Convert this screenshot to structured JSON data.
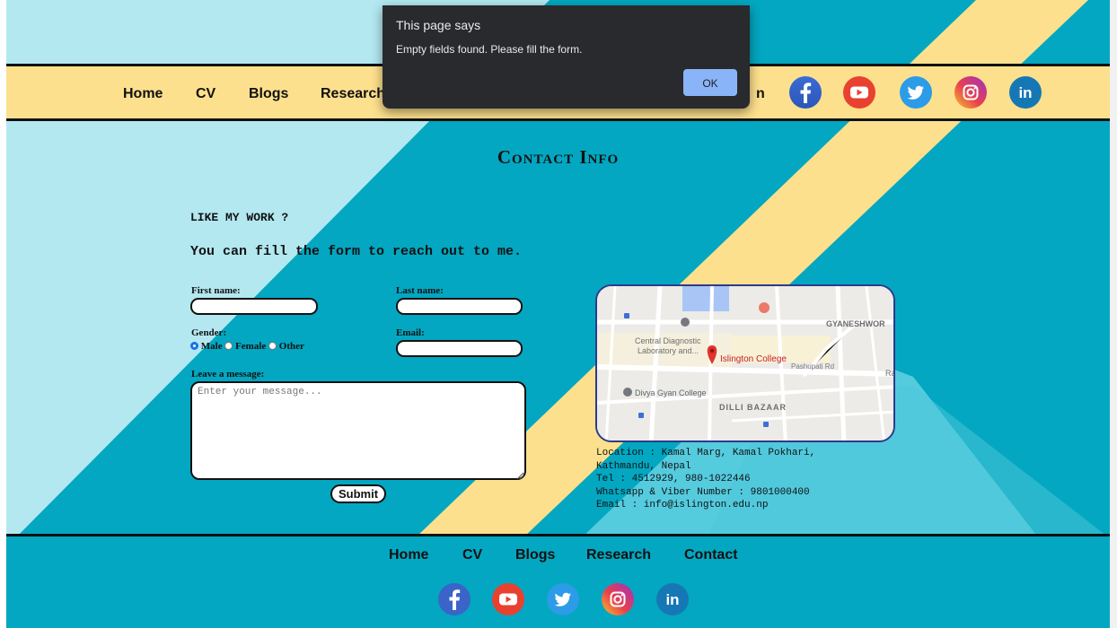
{
  "nav": {
    "links": [
      "Home",
      "CV",
      "Blogs",
      "Research",
      "Contact"
    ],
    "partial_label": "n"
  },
  "social": [
    "facebook-icon",
    "youtube-icon",
    "twitter-icon",
    "instagram-icon",
    "linkedin-icon"
  ],
  "page_title": "Contact Info",
  "intro": {
    "line1": "LIKE MY WORK ?",
    "line2": "You can fill the form to reach out to me."
  },
  "form": {
    "first_name_label": "First name:",
    "last_name_label": "Last name:",
    "gender_label": "Gender:",
    "gender_options": [
      "Male",
      "Female",
      "Other"
    ],
    "gender_selected": "Male",
    "email_label": "Email:",
    "message_label": "Leave a message:",
    "message_placeholder": "Enter your message...",
    "submit_label": "Submit"
  },
  "map": {
    "labels": {
      "gyaneshwor": "GYANESHWOR",
      "central_diagnostic": "Central Diagnostic",
      "laboratory": "Laboratory and...",
      "islington": "Islington College",
      "pashupati": "Pashupati Rd",
      "divya_gyan": "Divya Gyan College",
      "dilli_bazaar": "DILLI BAZAAR",
      "ra": "Ra"
    }
  },
  "contact": {
    "location": "Location : Kamal Marg, Kamal Pokhari,",
    "location2": "Kathmandu, Nepal",
    "tel": "Tel : 4512929, 980-1022446",
    "whatsapp": "Whatsapp & Viber Number : 9801000400",
    "email": "Email : info@islington.edu.np"
  },
  "footer": {
    "links": [
      "Home",
      "CV",
      "Blogs",
      "Research",
      "Contact"
    ]
  },
  "dialog": {
    "title": "This page says",
    "message": "Empty fields found. Please fill the form.",
    "ok_label": "OK"
  },
  "colors": {
    "teal": "#03a7c1",
    "light_blue": "#b3e8f0",
    "yellow": "#fde08d",
    "dialog_bg": "#292a2d",
    "ok_button": "#8ab4f8"
  }
}
